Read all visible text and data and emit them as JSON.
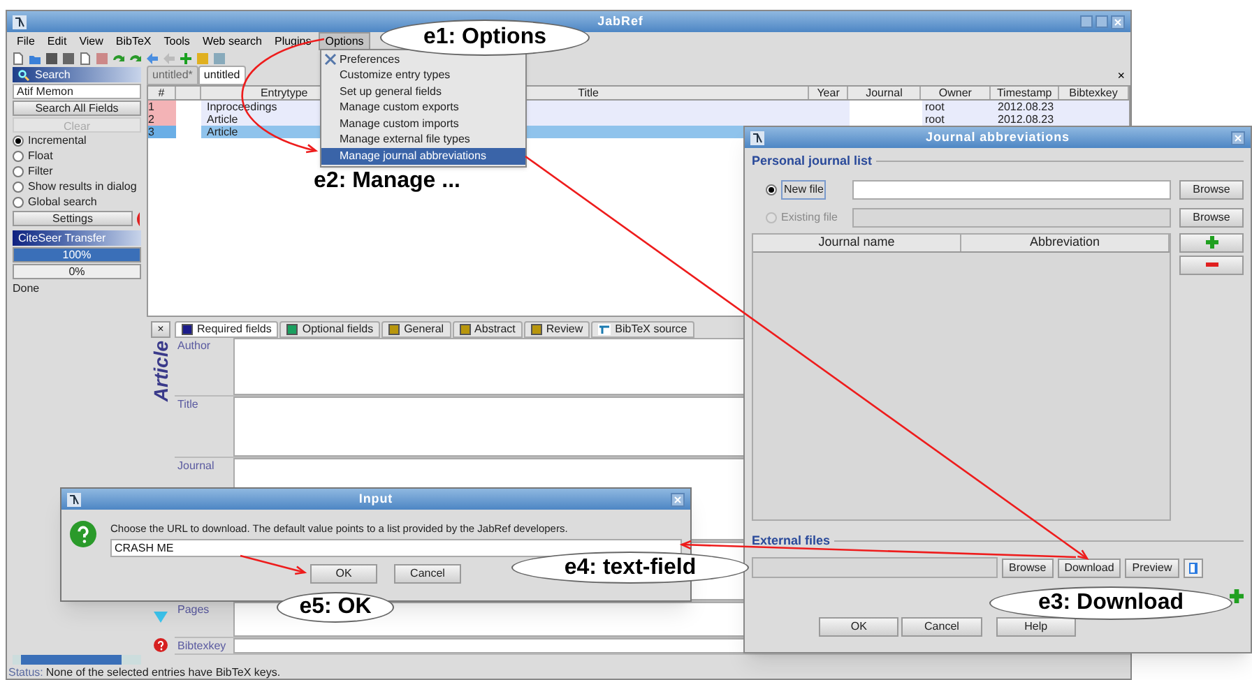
{
  "main_window": {
    "title": "JabRef"
  },
  "menu_bar": [
    {
      "label": "File",
      "selected": false
    },
    {
      "label": "Edit",
      "selected": false
    },
    {
      "label": "View",
      "selected": false
    },
    {
      "label": "BibTeX",
      "selected": false
    },
    {
      "label": "Tools",
      "selected": false
    },
    {
      "label": "Web search",
      "selected": false
    },
    {
      "label": "Plugins",
      "selected": false
    },
    {
      "label": "Options",
      "selected": true
    }
  ],
  "side_panel": {
    "title": "Search",
    "search_value": "Atif Memon",
    "search_button": "Search All Fields",
    "clear_button": "Clear",
    "modes": [
      {
        "label": "Incremental",
        "selected": true
      },
      {
        "label": "Float",
        "selected": false
      },
      {
        "label": "Filter",
        "selected": false
      },
      {
        "label": "Show results in dialog",
        "selected": false
      },
      {
        "label": "Global search",
        "selected": false
      }
    ],
    "settings_button": "Settings",
    "transfer_title": "CiteSeer Transfer",
    "progress": [
      {
        "text": "100%",
        "level": 1
      },
      {
        "text": "0%",
        "level": 0
      }
    ],
    "done": "Done"
  },
  "database_tabs": [
    {
      "label": "untitled*",
      "selected": false
    },
    {
      "label": "untitled",
      "selected": true
    }
  ],
  "close_tab": "×",
  "table": {
    "columns": [
      "#",
      "Entrytype",
      "Title",
      "Year",
      "Journal",
      "Owner",
      "Timestamp",
      "Bibtexkey"
    ],
    "rows": [
      {
        "number": "1",
        "entrytype": "Inproceedings",
        "owner": "root",
        "timestamp": "2012.08.23",
        "selected": false
      },
      {
        "number": "2",
        "entrytype": "Article",
        "owner": "root",
        "timestamp": "2012.08.23",
        "selected": false
      },
      {
        "number": "3",
        "entrytype": "Article",
        "selected": true
      }
    ]
  },
  "entry_editor": {
    "close": "×",
    "type_label": "Article",
    "tabs": [
      {
        "kind": "swatch",
        "label": "Required fields",
        "color": "#1c1c8a",
        "selected": true
      },
      {
        "kind": "swatch",
        "label": "Optional fields",
        "color": "#1aa060",
        "selected": false
      },
      {
        "kind": "swatch",
        "label": "General",
        "color": "#b8960c",
        "selected": false
      },
      {
        "kind": "swatch",
        "label": "Abstract",
        "color": "#b8960c",
        "selected": false
      },
      {
        "kind": "swatch",
        "label": "Review",
        "color": "#b8960c",
        "selected": false
      },
      {
        "kind": "source",
        "label": "BibTeX source",
        "selected": false
      }
    ],
    "fields": [
      "Author",
      "Title",
      "Journal",
      "Pages",
      "Bibtexkey"
    ]
  },
  "status_bar": {
    "label": "Status:",
    "text": "None of the selected entries have BibTeX keys."
  },
  "options_menu": [
    {
      "label": "Preferences",
      "selected": false
    },
    {
      "label": "Customize entry types",
      "selected": false
    },
    {
      "label": "Set up general fields",
      "selected": false
    },
    {
      "label": "Manage custom exports",
      "selected": false
    },
    {
      "label": "Manage custom imports",
      "selected": false
    },
    {
      "label": "Manage external file types",
      "selected": false
    },
    {
      "label": "Manage journal abbreviations",
      "selected": true
    }
  ],
  "journal_dialog": {
    "title": "Journal abbreviations",
    "personal_section": "Personal journal list",
    "file_options": [
      {
        "label": "New file",
        "selected": true,
        "disabled": false
      },
      {
        "label": "Existing file",
        "selected": false,
        "disabled": true
      }
    ],
    "browse_buttons": [
      "Browse",
      "Browse"
    ],
    "columns": [
      "Journal name",
      "Abbreviation"
    ],
    "external_section": "External files",
    "external_buttons": [
      "Browse",
      "Download",
      "Preview"
    ],
    "footer_buttons": [
      "OK",
      "Cancel",
      "Help"
    ]
  },
  "input_dialog": {
    "title": "Input",
    "message": "Choose the URL to download. The default value points to a list provided by the JabRef developers.",
    "value": "CRASH ME",
    "buttons": [
      "OK",
      "Cancel"
    ]
  },
  "callouts": [
    {
      "text": "e1: Options",
      "kind": "oval"
    },
    {
      "text": "e2: Manage ...",
      "kind": "plain"
    },
    {
      "text": "e3: Download",
      "kind": "oval"
    },
    {
      "text": "e4: text-field",
      "kind": "oval"
    },
    {
      "text": "e5: OK",
      "kind": "oval"
    }
  ]
}
